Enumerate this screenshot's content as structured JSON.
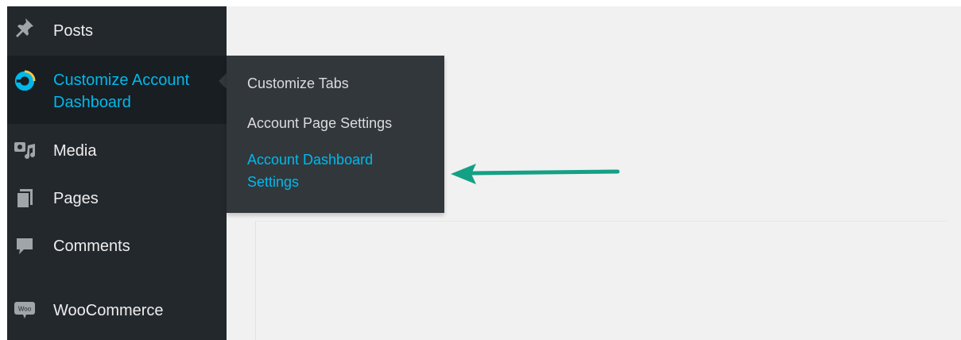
{
  "sidebar": {
    "items": [
      {
        "label": "Posts",
        "icon": "pushpin-icon"
      },
      {
        "label": "Customize Account Dashboard",
        "label_line1": "Customize Account",
        "label_line2": "Dashboard",
        "icon": "customize-account-dashboard-icon",
        "current": true
      },
      {
        "label": "Media",
        "icon": "media-icon"
      },
      {
        "label": "Pages",
        "icon": "pages-icon"
      },
      {
        "label": "Comments",
        "icon": "comments-icon"
      },
      {
        "label": "WooCommerce",
        "icon": "woocommerce-icon",
        "icon_text": "Woo"
      }
    ]
  },
  "submenu": {
    "items": [
      {
        "label": "Customize Tabs"
      },
      {
        "label": "Account Page Settings"
      },
      {
        "label": "Account Dashboard Settings",
        "label_line1": "Account Dashboard",
        "label_line2": "Settings",
        "active": true
      }
    ]
  },
  "colors": {
    "sidebar_bg": "#23282d",
    "submenu_bg": "#32373c",
    "accent": "#00b9eb",
    "arrow": "#14a085",
    "content_bg": "#f1f1f1"
  }
}
